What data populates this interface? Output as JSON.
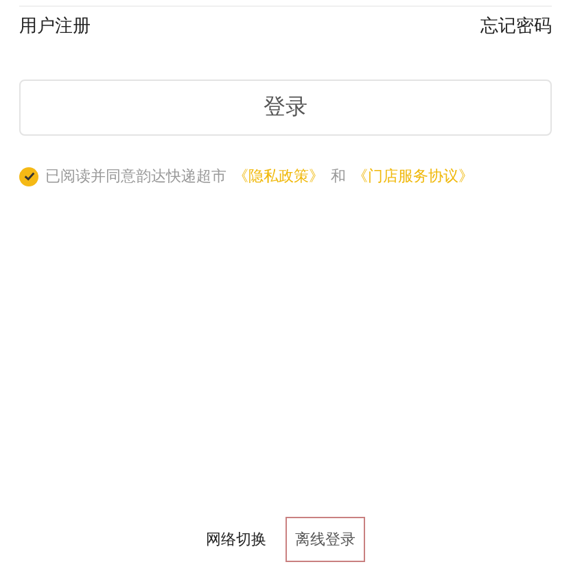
{
  "links": {
    "register": "用户注册",
    "forgot": "忘记密码"
  },
  "login_button": "登录",
  "agreement": {
    "checked": true,
    "text": "已阅读并同意韵达快递超市",
    "privacy": "《隐私政策》",
    "and": "和",
    "service": "《门店服务协议》"
  },
  "footer": {
    "network": "网络切换",
    "offline": "离线登录"
  }
}
